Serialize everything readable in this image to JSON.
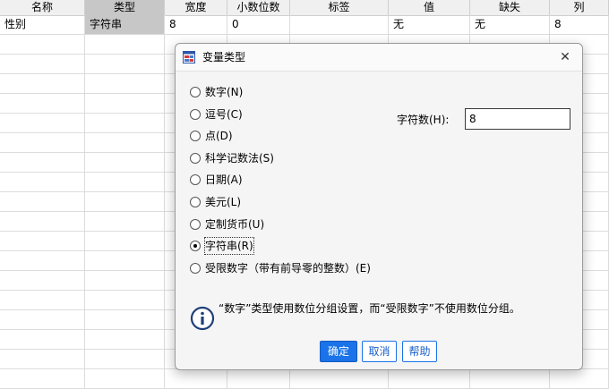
{
  "grid": {
    "columns": [
      "名称",
      "类型",
      "宽度",
      "小数位数",
      "标签",
      "值",
      "缺失",
      "列"
    ],
    "row1": [
      "性别",
      "字符串",
      "8",
      "0",
      "",
      "无",
      "无",
      "8"
    ]
  },
  "dialog": {
    "title": "变量类型",
    "close_symbol": "✕",
    "options": [
      {
        "label": "数字(N)",
        "selected": false
      },
      {
        "label": "逗号(C)",
        "selected": false
      },
      {
        "label": "点(D)",
        "selected": false
      },
      {
        "label": "科学记数法(S)",
        "selected": false
      },
      {
        "label": "日期(A)",
        "selected": false
      },
      {
        "label": "美元(L)",
        "selected": false
      },
      {
        "label": "定制货币(U)",
        "selected": false
      },
      {
        "label": "字符串(R)",
        "selected": true
      },
      {
        "label": "受限数字（带有前导零的整数）(E)",
        "selected": false
      }
    ],
    "chars_label": "字符数(H):",
    "chars_value": "8",
    "info_text": "“数字”类型使用数位分组设置，而“受限数字”不使用数位分组。",
    "buttons": {
      "ok": "确定",
      "cancel": "取消",
      "help": "帮助"
    },
    "colors": {
      "primary": "#1a73e8",
      "selected_cell": "#c7c7c7"
    }
  }
}
